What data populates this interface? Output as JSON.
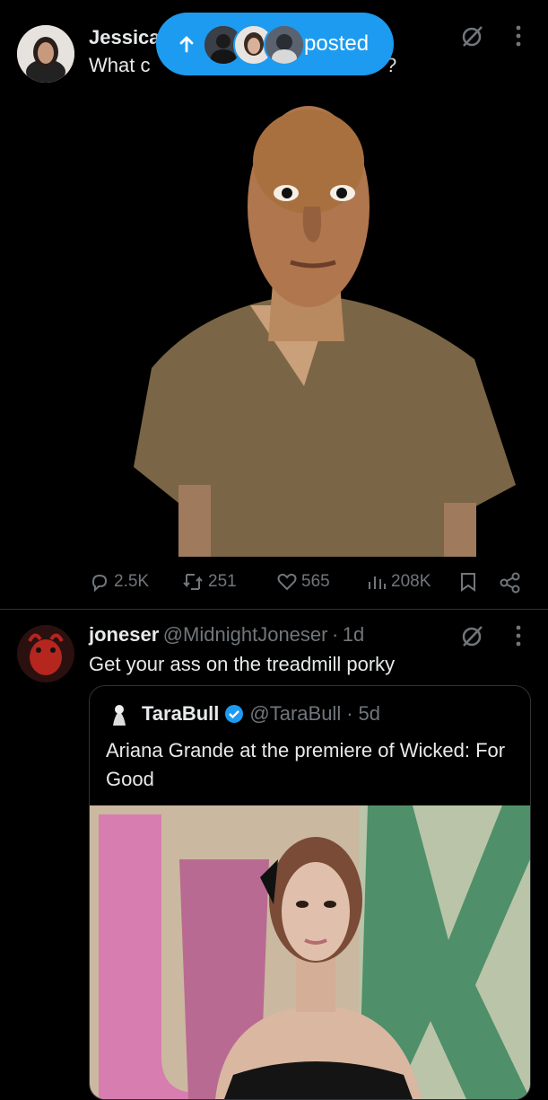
{
  "post1": {
    "author_name": "Jessica",
    "text_visible_start": "What c",
    "text_visible_end": "?",
    "stats": {
      "replies": "2.5K",
      "reposts": "251",
      "likes": "565",
      "views": "208K"
    }
  },
  "posted_pill": {
    "label": "posted"
  },
  "post2": {
    "author_name": "joneser",
    "handle": "@MidnightJoneser",
    "dot": "·",
    "time": "1d",
    "text": "Get your ass on the treadmill porky",
    "quote": {
      "author_name": "TaraBull",
      "handle": "@TaraBull",
      "dot": "·",
      "time": "5d",
      "text": "Ariana Grande at the premiere of Wicked: For Good"
    }
  },
  "colors": {
    "background": "#000000",
    "accent": "#1d9bf0",
    "muted": "#71767b",
    "divider": "#2f3336",
    "text": "#e7e9ea"
  },
  "icons": [
    "grok-icon",
    "more-icon",
    "reply-icon",
    "repost-icon",
    "like-icon",
    "views-icon",
    "bookmark-icon",
    "share-icon",
    "verified-badge-icon",
    "up-arrow-icon"
  ]
}
